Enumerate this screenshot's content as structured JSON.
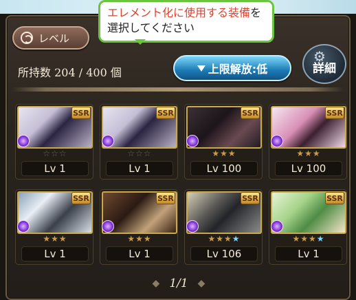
{
  "tooltip": {
    "highlight": "エレメント化に使用する装備",
    "rest1": "を",
    "line2": "選択してください"
  },
  "sort_button": {
    "label": "レベル",
    "icon": "refresh-icon"
  },
  "owned": {
    "label": "所持数",
    "current": "204",
    "separator": "/",
    "max": "400",
    "unit": "個"
  },
  "limit_button": {
    "label": "上限解放:低",
    "icon": "triangle-down-icon"
  },
  "detail_button": {
    "label": "詳細",
    "icon": "gear-icon"
  },
  "cards": [
    {
      "rarity": "SSR",
      "stars": {
        "filled": 0,
        "empty": 3,
        "blue": 0
      },
      "stars_text": [
        "☆",
        "☆",
        "☆"
      ],
      "level": "Lv 1",
      "element": "dark-element-icon"
    },
    {
      "rarity": "SSR",
      "stars": {
        "filled": 0,
        "empty": 3,
        "blue": 0
      },
      "stars_text": [
        "☆",
        "☆",
        "☆"
      ],
      "level": "Lv 1",
      "element": "dark-element-icon"
    },
    {
      "rarity": "SSR",
      "stars": {
        "filled": 3,
        "empty": 0,
        "blue": 0
      },
      "stars_text": [
        "★",
        "★",
        "★"
      ],
      "level": "Lv 100",
      "element": "dark-element-icon"
    },
    {
      "rarity": "SSR",
      "stars": {
        "filled": 3,
        "empty": 0,
        "blue": 0
      },
      "stars_text": [
        "★",
        "★",
        "★"
      ],
      "level": "Lv 100",
      "element": "dark-element-icon"
    },
    {
      "rarity": "SSR",
      "stars": {
        "filled": 3,
        "empty": 0,
        "blue": 0
      },
      "stars_text": [
        "★",
        "★",
        "★"
      ],
      "level": "Lv 1",
      "element": "dark-element-icon"
    },
    {
      "rarity": "SSR",
      "stars": {
        "filled": 3,
        "empty": 0,
        "blue": 0
      },
      "stars_text": [
        "★",
        "★",
        "★"
      ],
      "level": "Lv 1",
      "element": "dark-element-icon"
    },
    {
      "rarity": "SSR",
      "stars": {
        "filled": 3,
        "empty": 0,
        "blue": 1
      },
      "stars_text": [
        "★",
        "★",
        "★",
        "★"
      ],
      "level": "Lv 106",
      "element": "dark-element-icon"
    },
    {
      "rarity": "SSR",
      "stars": {
        "filled": 3,
        "empty": 0,
        "blue": 1
      },
      "stars_text": [
        "★",
        "★",
        "★",
        "★"
      ],
      "level": "Lv 1",
      "element": "dark-element-icon"
    }
  ],
  "pager": {
    "label": "1/1",
    "prev_icon": "chevron-left-icon",
    "next_icon": "chevron-right-icon"
  }
}
